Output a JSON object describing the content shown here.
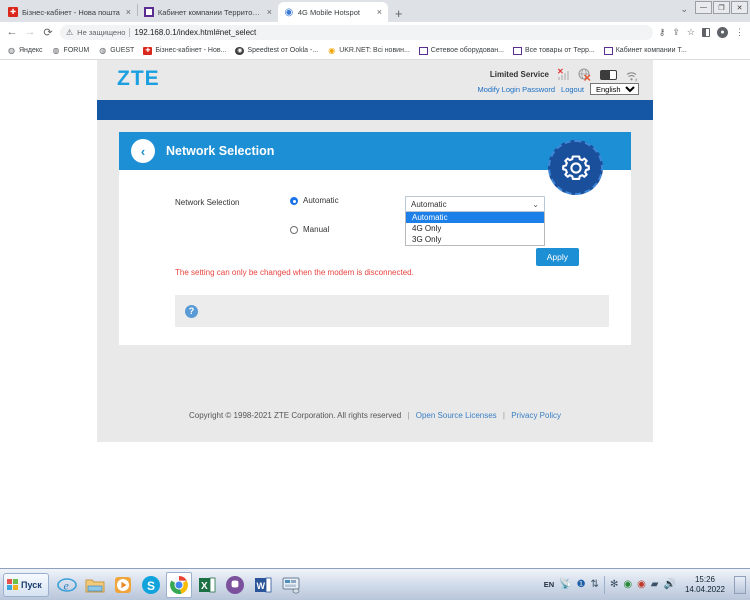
{
  "browser": {
    "tabs": [
      {
        "title": "Бізнес-кабінет - Нова пошта",
        "favicon": "novaposhta-icon",
        "active": false,
        "close": "×"
      },
      {
        "title": "Кабинет компании Территория ис",
        "favicon": "square-purple-icon",
        "active": false,
        "close": "×"
      },
      {
        "title": "4G Mobile Hotspot",
        "favicon": "globe-blue-icon",
        "active": true,
        "close": "×"
      }
    ],
    "new_tab_label": "+",
    "tab_list_caret": "⌄",
    "window_controls": {
      "minimize": "—",
      "maximize": "❐",
      "close": "✕"
    },
    "nav": {
      "back": "←",
      "forward": "→",
      "reload": "⟳"
    },
    "omnibox": {
      "warning_icon": "warning-triangle-icon",
      "security_text": "Не защищено",
      "url": "192.168.0.1/index.html#net_select"
    },
    "toolbar_icons": [
      "key-icon",
      "share-icon",
      "star-icon",
      "side-panel-icon",
      "profile-avatar-icon",
      "three-dot-menu-icon"
    ],
    "bookmarks": [
      {
        "label": "Яндекс",
        "icon": "globe-icon"
      },
      {
        "label": "FORUM",
        "icon": "globe-icon"
      },
      {
        "label": "GUEST",
        "icon": "globe-icon"
      },
      {
        "label": "Бізнес-кабінет - Нов...",
        "icon": "novaposhta-icon"
      },
      {
        "label": "Speedtest от Ookla -...",
        "icon": "speedtest-icon"
      },
      {
        "label": "UKR.NET: Всі новин...",
        "icon": "ukrnet-icon"
      },
      {
        "label": "Сетевое оборудован...",
        "icon": "square-purple-icon"
      },
      {
        "label": "Все товары от Терр...",
        "icon": "square-purple-icon"
      },
      {
        "label": "Кабинет компании Т...",
        "icon": "square-purple-icon"
      }
    ]
  },
  "zte": {
    "logo": "ZTE",
    "status": {
      "service_text": "Limited Service",
      "signal_icon": "signal-bars-disabled-icon",
      "network_icon": "globe-disabled-icon",
      "battery_icon": "battery-icon",
      "wifi_icon": "wifi-disabled-icon"
    },
    "links": {
      "modify_password": "Modify Login Password",
      "logout": "Logout",
      "language": "English"
    },
    "card": {
      "back_icon": "chevron-left-icon",
      "title": "Network Selection",
      "gear_icon": "gear-icon"
    },
    "form": {
      "field_label": "Network Selection",
      "radios": [
        {
          "label": "Automatic",
          "selected": true
        },
        {
          "label": "Manual",
          "selected": false
        }
      ],
      "select": {
        "value": "Automatic",
        "caret": "⌄",
        "open": true,
        "options": [
          {
            "label": "Automatic",
            "highlighted": true
          },
          {
            "label": "4G Only",
            "highlighted": false
          },
          {
            "label": "3G Only",
            "highlighted": false
          }
        ]
      },
      "apply_label": "Apply",
      "warning": "The setting can only be changed when the modem is disconnected.",
      "help_icon": "question-mark-icon"
    },
    "footer": {
      "copyright": "Copyright © 1998-2021 ZTE Corporation. All rights reserved",
      "sep1": "|",
      "open_source": "Open Source Licenses",
      "sep2": "|",
      "privacy": "Privacy Policy"
    },
    "colors": {
      "logo_blue": "#1a9fe0",
      "banner_blue": "#1556a5",
      "card_header_blue": "#1d8fd4",
      "gear_blue": "#1a4f9c",
      "warning_red": "#e8433f",
      "link_blue": "#1a6fc4",
      "select_highlight": "#1d7fe8"
    }
  },
  "taskbar": {
    "start_label": "Пуск",
    "apps": [
      {
        "name": "internet-explorer-icon",
        "glyph": "e",
        "active": false
      },
      {
        "name": "file-explorer-icon",
        "glyph": "🗂",
        "active": false
      },
      {
        "name": "media-player-icon",
        "glyph": "▶",
        "active": false
      },
      {
        "name": "skype-icon",
        "glyph": "S",
        "active": false
      },
      {
        "name": "chrome-icon",
        "glyph": "◉",
        "active": true
      },
      {
        "name": "excel-icon",
        "glyph": "X",
        "active": false
      },
      {
        "name": "viber-icon",
        "glyph": "✆",
        "active": false
      },
      {
        "name": "word-icon",
        "glyph": "W",
        "active": false
      },
      {
        "name": "network-tool-icon",
        "glyph": "▤",
        "active": false
      }
    ],
    "tray": {
      "language": "EN",
      "icons": [
        "satellite-icon",
        "help-circle-icon",
        "sync-icon",
        "bluetooth-icon",
        "shield-ok-icon",
        "shield-error-icon",
        "signal-icon",
        "volume-icon"
      ],
      "time": "15:26",
      "date": "14.04.2022",
      "show_desktop": "show-desktop-icon"
    }
  }
}
